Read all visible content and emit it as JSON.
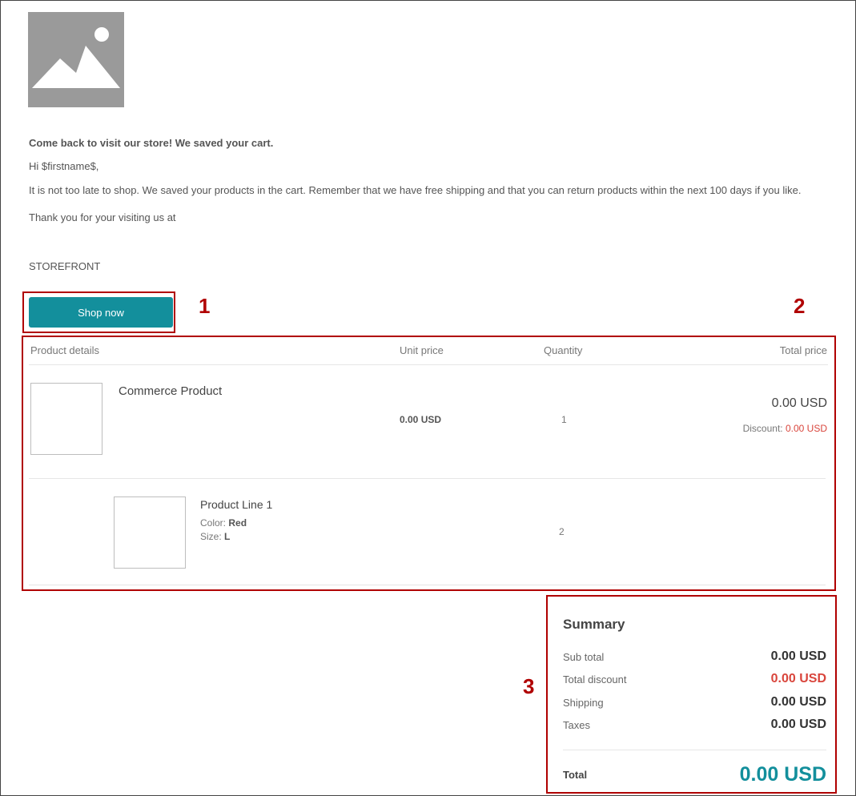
{
  "email": {
    "heading": "Come back to visit our store! We saved your cart.",
    "greeting": "Hi $firstname$,",
    "body": "It is not too late to shop.  We saved your products in the cart.  Remember that we have free shipping and that you can return products within the next 100 days if you like.",
    "thanks": "Thank you for your visiting us at",
    "store": "STOREFRONT",
    "button": "Shop now"
  },
  "callouts": [
    "1",
    "2",
    "3"
  ],
  "table": {
    "headers": {
      "product": "Product details",
      "unit": "Unit price",
      "qty": "Quantity",
      "total": "Total price"
    },
    "product": {
      "name": "Commerce Product",
      "unit_price": "0.00 USD",
      "quantity": "1",
      "total": "0.00 USD",
      "discount_label": "Discount:",
      "discount_value": "0.00 USD"
    },
    "line": {
      "name": "Product Line 1",
      "color_label": "Color:",
      "color_value": "Red",
      "size_label": "Size:",
      "size_value": "L",
      "quantity": "2"
    }
  },
  "summary": {
    "title": "Summary",
    "subtotal_label": "Sub total",
    "subtotal": "0.00 USD",
    "discount_label": "Total discount",
    "discount": "0.00 USD",
    "shipping_label": "Shipping",
    "shipping": "0.00 USD",
    "taxes_label": "Taxes",
    "taxes": "0.00 USD",
    "total_label": "Total",
    "total": "0.00 USD"
  },
  "colors": {
    "accent": "#138f9c",
    "callout": "#b00000",
    "discount": "#d9453c",
    "placeholder": "#9a9a9a"
  },
  "icons": {
    "hero": "image-placeholder-icon"
  }
}
